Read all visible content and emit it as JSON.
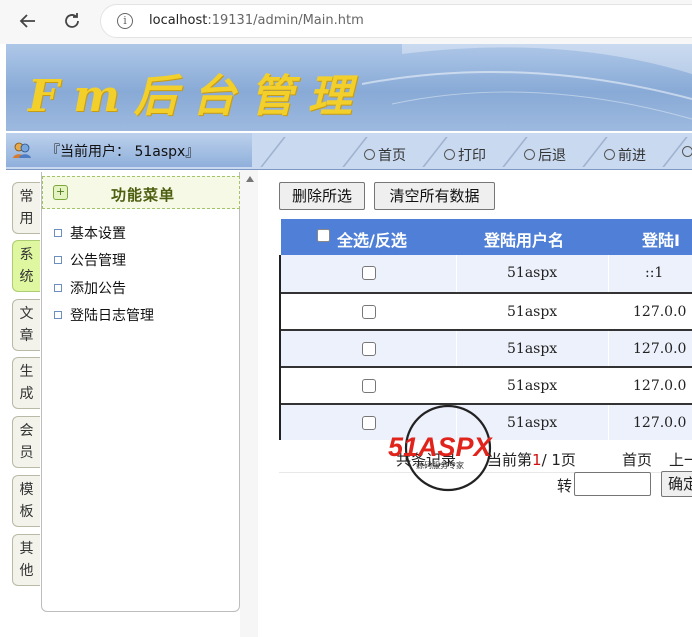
{
  "browser": {
    "url_host": "localhost",
    "url_rest": ":19131/admin/Main.htm"
  },
  "banner": {
    "title": "Fm后台管理"
  },
  "topbar": {
    "user_label": "『当前用户： 51aspx』",
    "nav": [
      "首页",
      "打印",
      "后退",
      "前进"
    ]
  },
  "left_tabs": [
    {
      "label": "常用",
      "active": false
    },
    {
      "label": "系统",
      "active": true
    },
    {
      "label": "文章",
      "active": false
    },
    {
      "label": "生成",
      "active": false
    },
    {
      "label": "会员",
      "active": false
    },
    {
      "label": "模板",
      "active": false
    },
    {
      "label": "其他",
      "active": false
    }
  ],
  "menu": {
    "title": "功能菜单",
    "items": [
      "基本设置",
      "公告管理",
      "添加公告",
      "登陆日志管理"
    ]
  },
  "toolbar": {
    "delete_selected": "删除所选",
    "clear_all": "清空所有数据"
  },
  "grid": {
    "columns": [
      "全选/反选",
      "登陆用户名",
      "登陆I"
    ],
    "rows": [
      {
        "user": "51aspx",
        "ip": "::1"
      },
      {
        "user": "51aspx",
        "ip": "127.0.0"
      },
      {
        "user": "51aspx",
        "ip": "127.0.0"
      },
      {
        "user": "51aspx",
        "ip": "127.0.0"
      },
      {
        "user": "51aspx",
        "ip": "127.0.0"
      }
    ]
  },
  "pager": {
    "total_prefix": "共",
    "total_suffix": "条记录",
    "current_prefix": "当前第",
    "current_page": "1",
    "page_sep": "/ 1页",
    "first": "首页",
    "prev": "上一",
    "goto_label": "转",
    "confirm": "确定"
  },
  "watermark": {
    "text": "51ASPX",
    "subtitle": "源码服务专家"
  }
}
